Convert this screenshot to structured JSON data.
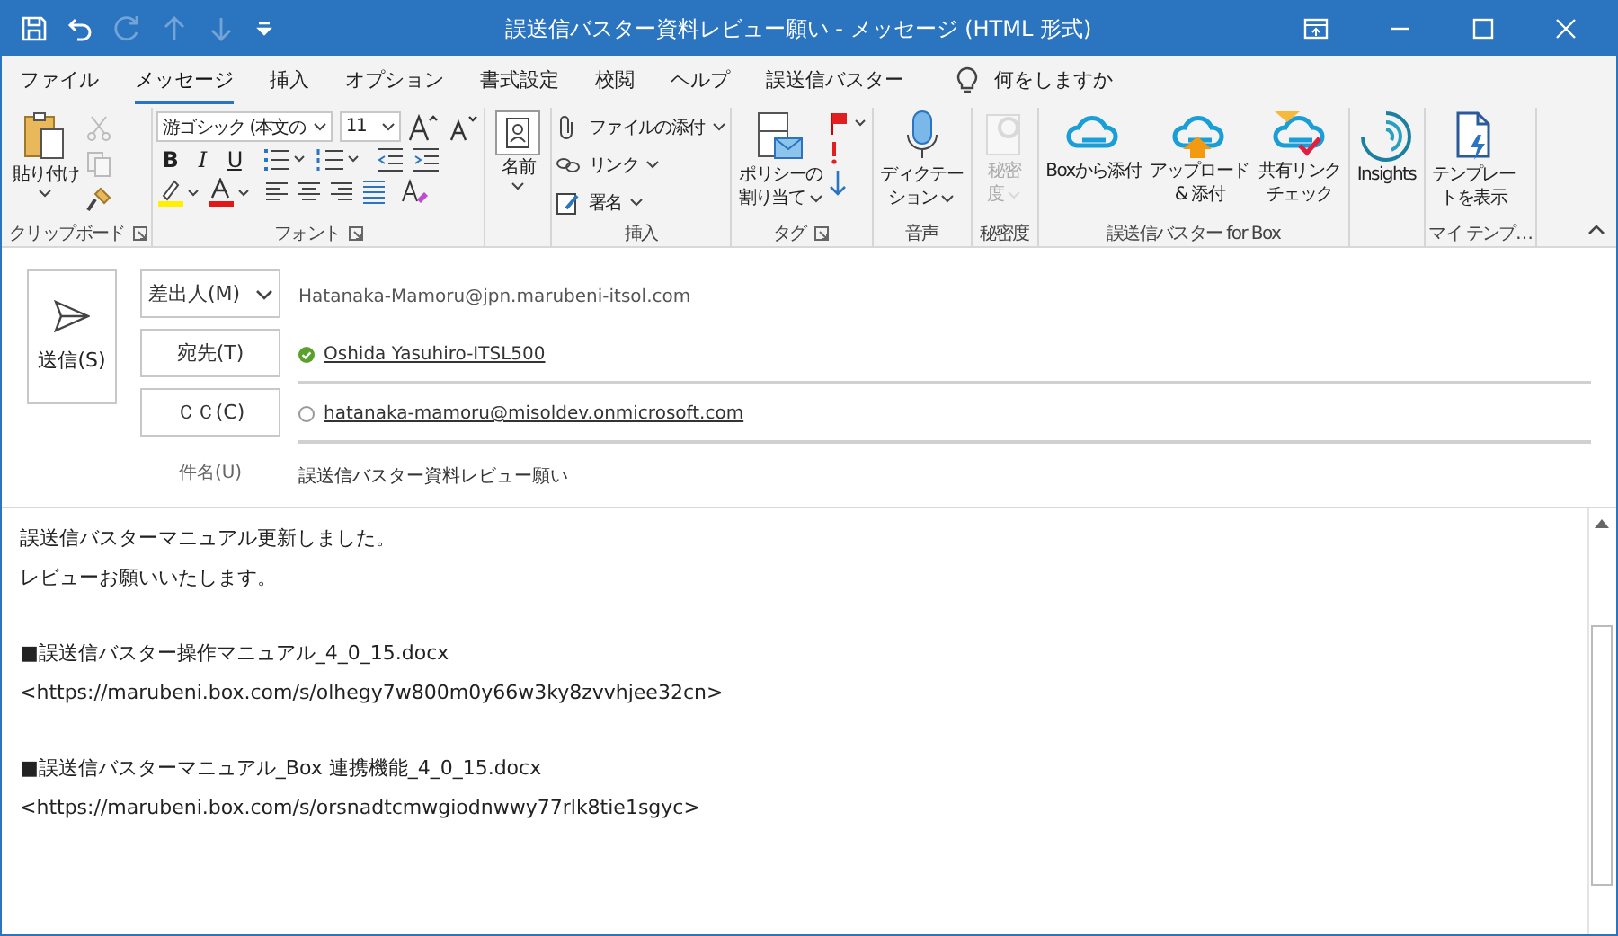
{
  "window": {
    "title": "誤送信バスター資料レビュー願い  -  メッセージ (HTML 形式)",
    "quick_access": [
      {
        "kind": "save",
        "disabled": false
      },
      {
        "kind": "undo",
        "disabled": false
      },
      {
        "kind": "redo",
        "disabled": true
      },
      {
        "kind": "up",
        "disabled": true
      },
      {
        "kind": "down",
        "disabled": true
      },
      {
        "kind": "customize",
        "disabled": false
      }
    ]
  },
  "tabs": [
    {
      "label": "ファイル",
      "selected": false
    },
    {
      "label": "メッセージ",
      "selected": true
    },
    {
      "label": "挿入",
      "selected": false
    },
    {
      "label": "オプション",
      "selected": false
    },
    {
      "label": "書式設定",
      "selected": false
    },
    {
      "label": "校閲",
      "selected": false
    },
    {
      "label": "ヘルプ",
      "selected": false
    },
    {
      "label": "誤送信バスター",
      "selected": false
    }
  ],
  "tell_me": {
    "label": "何をしますか"
  },
  "ribbon": {
    "clipboard": {
      "label": "クリップボード",
      "paste": "貼り付け",
      "cut_disabled": true,
      "copy_disabled": true
    },
    "font": {
      "label": "フォント",
      "font_name": "游ゴシック (本文の",
      "font_size": "11",
      "bold": "B",
      "italic": "I",
      "underline": "U"
    },
    "names": {
      "button": "名前"
    },
    "insert": {
      "label": "挿入",
      "items": [
        "ファイルの添付",
        "リンク",
        "署名"
      ]
    },
    "tags": {
      "label": "タグ",
      "policy": [
        "ポリシーの",
        "割り当て"
      ]
    },
    "voice": {
      "label": "音声",
      "dictate": [
        "ディクテー",
        "ション"
      ]
    },
    "sensitivity": {
      "label": "秘密度",
      "button": [
        "秘密",
        "度"
      ],
      "disabled": true
    },
    "box": {
      "label": "誤送信バスター for Box",
      "buttons": [
        [
          "Boxから添付"
        ],
        [
          "アップロード",
          "& 添付"
        ],
        [
          "共有リンク",
          "チェック"
        ]
      ]
    },
    "insights": {
      "button": "Insights"
    },
    "templates": {
      "label": "マイ テンプ…",
      "button": [
        "テンプレー",
        "トを表示"
      ]
    }
  },
  "header": {
    "send": "送信(S)",
    "from": {
      "button": "差出人(M)",
      "value": "Hatanaka-Mamoru@jpn.marubeni-itsol.com"
    },
    "to": {
      "button": "宛先(T)",
      "recipients": [
        {
          "name": "Oshida Yasuhiro-ITSL500",
          "resolved": true
        }
      ]
    },
    "cc": {
      "button": "ＣＣ(C)",
      "recipients": [
        {
          "name": "hatanaka-mamoru@misoldev.onmicrosoft.com",
          "resolved": false
        }
      ]
    },
    "subject": {
      "label": "件名(U)",
      "value": "誤送信バスター資料レビュー願い"
    }
  },
  "body": {
    "paragraphs": [
      [
        "誤送信バスターマニュアル更新しました。",
        "レビューお願いいたします。"
      ],
      [
        "■誤送信バスター操作マニュアル_4_0_15.docx",
        "<https://marubeni.box.com/s/olhegy7w800m0y66w3ky8zvvhjee32cn>"
      ],
      [
        "■誤送信バスターマニュアル_Box 連携機能_4_0_15.docx",
        "<https://marubeni.box.com/s/orsnadtcmwgiodnwwy77rlk8tie1sgyc>"
      ]
    ]
  }
}
